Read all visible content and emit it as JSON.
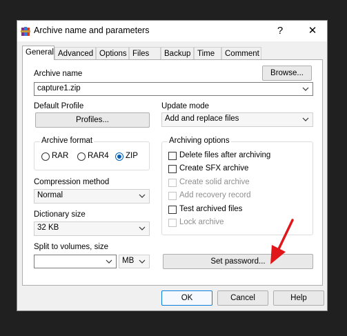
{
  "window": {
    "title": "Archive name and parameters",
    "help_glyph": "?",
    "close_glyph": "✕"
  },
  "tabs": [
    "General",
    "Advanced",
    "Options",
    "Files",
    "Backup",
    "Time",
    "Comment"
  ],
  "general": {
    "archive_name_label": "Archive name",
    "browse_label": "Browse...",
    "archive_name_value": "capture1.zip",
    "default_profile_label": "Default Profile",
    "profiles_label": "Profiles...",
    "update_mode_label": "Update mode",
    "update_mode_value": "Add and replace files",
    "archive_format_label": "Archive format",
    "formats": [
      "RAR",
      "RAR4",
      "ZIP"
    ],
    "selected_format": "ZIP",
    "compression_label": "Compression method",
    "compression_value": "Normal",
    "dictionary_label": "Dictionary size",
    "dictionary_value": "32 KB",
    "split_label": "Split to volumes, size",
    "split_value": "",
    "split_unit": "MB",
    "archiving_options_label": "Archiving options",
    "options": [
      {
        "label": "Delete files after archiving",
        "enabled": true,
        "checked": false
      },
      {
        "label": "Create SFX archive",
        "enabled": true,
        "checked": false
      },
      {
        "label": "Create solid archive",
        "enabled": false,
        "checked": false
      },
      {
        "label": "Add recovery record",
        "enabled": false,
        "checked": false
      },
      {
        "label": "Test archived files",
        "enabled": true,
        "checked": false
      },
      {
        "label": "Lock archive",
        "enabled": false,
        "checked": false
      }
    ],
    "set_password_label": "Set password..."
  },
  "footer": {
    "ok_label": "OK",
    "cancel_label": "Cancel",
    "help_label": "Help"
  },
  "colors": {
    "accent": "#005fb8",
    "annotation_arrow": "#e0161b",
    "background": "#202020"
  },
  "icons": {
    "app": "winrar-books-icon",
    "annotation": "red-arrow-icon"
  }
}
